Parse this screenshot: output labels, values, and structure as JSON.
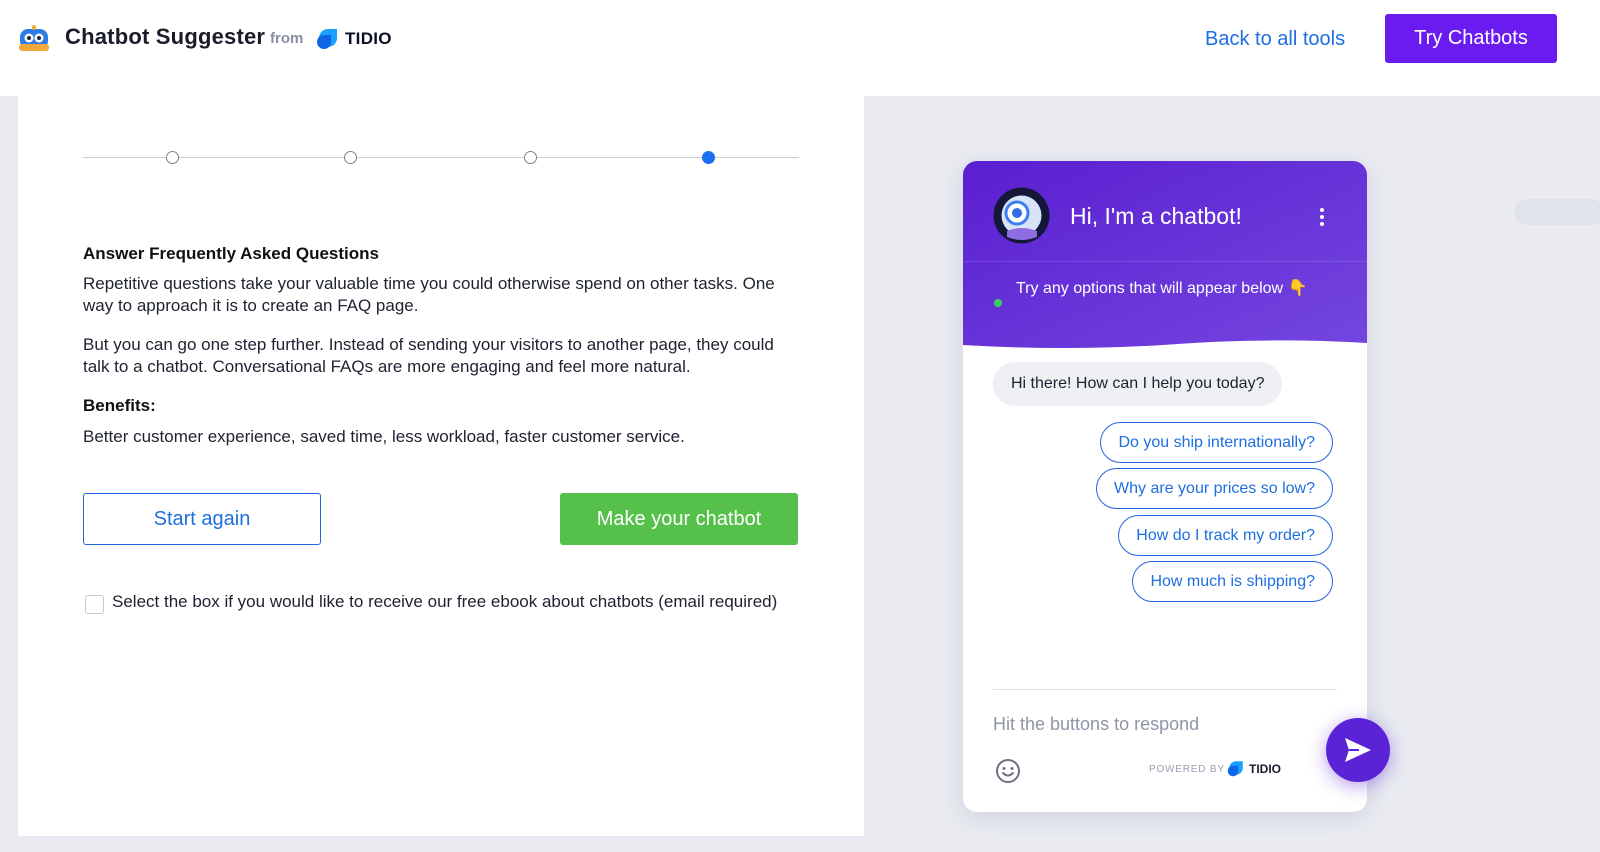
{
  "header": {
    "app_title": "Chatbot Suggester",
    "from_text": "from",
    "brand_name": "TIDIO",
    "back_link": "Back to all tools",
    "try_button": "Try Chatbots"
  },
  "colors": {
    "accent_purple": "#6a1cf0",
    "link_blue": "#1e6fe0",
    "success_green": "#55c04a",
    "chat_header_purple": "#5b2bd6"
  },
  "stepper": {
    "total_steps": 4,
    "active_step": 4
  },
  "main": {
    "section_title": "Answer Frequently Asked Questions",
    "paragraph_1": "Repetitive questions take your valuable time you could otherwise spend on other tasks. One way to approach it is to create an FAQ page.",
    "paragraph_2": "But you can go one step further. Instead of sending your visitors to another page, they could talk to a chatbot. Conversational FAQs are more engaging and feel more natural.",
    "benefits_title": "Benefits:",
    "benefits_text": "Better customer experience, saved time, less workload, faster customer service.",
    "start_again_button": "Start again",
    "make_chatbot_button": "Make your chatbot",
    "ebook_checkbox_checked": false,
    "ebook_checkbox_label": "Select the box if you would like to receive our free ebook about chatbots (email required)"
  },
  "chat": {
    "title": "Hi, I'm a chatbot!",
    "subtitle": "Try any options that will appear below 👇",
    "bot_message": "Hi there! How can I help you today?",
    "options": [
      "Do you ship internationally?",
      "Why are your prices so low?",
      "How do I track my order?",
      "How much is shipping?"
    ],
    "input_placeholder": "Hit the buttons to respond",
    "powered_by": "POWERED BY",
    "powered_brand": "TIDIO"
  }
}
